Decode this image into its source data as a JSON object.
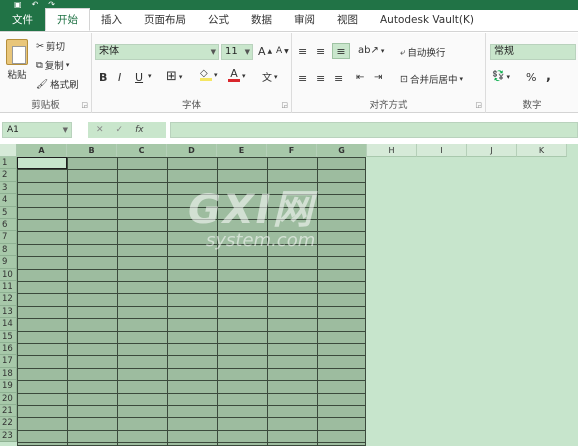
{
  "quick_access": {
    "save_icon": "save-icon",
    "undo_icon": "undo-icon",
    "redo_icon": "redo-icon"
  },
  "tabs": [
    {
      "label": "文件",
      "kind": "file"
    },
    {
      "label": "开始",
      "kind": "active"
    },
    {
      "label": "插入"
    },
    {
      "label": "页面布局"
    },
    {
      "label": "公式"
    },
    {
      "label": "数据"
    },
    {
      "label": "审阅"
    },
    {
      "label": "视图"
    },
    {
      "label": "Autodesk Vault(K)"
    }
  ],
  "ribbon": {
    "clipboard": {
      "paste": "粘贴",
      "cut": "剪切",
      "copy": "复制",
      "format_painter": "格式刷",
      "group": "剪贴板"
    },
    "font": {
      "font_name": "宋体",
      "font_size": "11",
      "grow": "A",
      "shrink": "A",
      "bold": "B",
      "italic": "I",
      "underline": "U",
      "fill_color": "#f5e663",
      "font_color": "#d9262c",
      "group": "字体"
    },
    "alignment": {
      "wrap_text": "自动换行",
      "merge_center": "合并后居中",
      "group": "对齐方式"
    },
    "number": {
      "format": "常规",
      "percent": "%",
      "comma": ",",
      "group": "数字"
    }
  },
  "formula_bar": {
    "name_box": "A1",
    "cancel": "✕",
    "enter": "✓",
    "fx": "fx",
    "value": ""
  },
  "sheet": {
    "columns": [
      "A",
      "B",
      "C",
      "D",
      "E",
      "F",
      "G",
      "H",
      "I",
      "J",
      "K"
    ],
    "selected_columns": 7,
    "rows": [
      "1",
      "2",
      "3",
      "4",
      "5",
      "6",
      "7",
      "8",
      "9",
      "10",
      "11",
      "12",
      "13",
      "14",
      "15",
      "16",
      "17",
      "18",
      "19",
      "20",
      "21",
      "22",
      "23"
    ]
  },
  "watermark": {
    "big": "GXI网",
    "small": "system.com"
  },
  "colors": {
    "accent": "#217346",
    "grid_bg": "#c7e5cc",
    "selection": "#9dbc9f"
  }
}
